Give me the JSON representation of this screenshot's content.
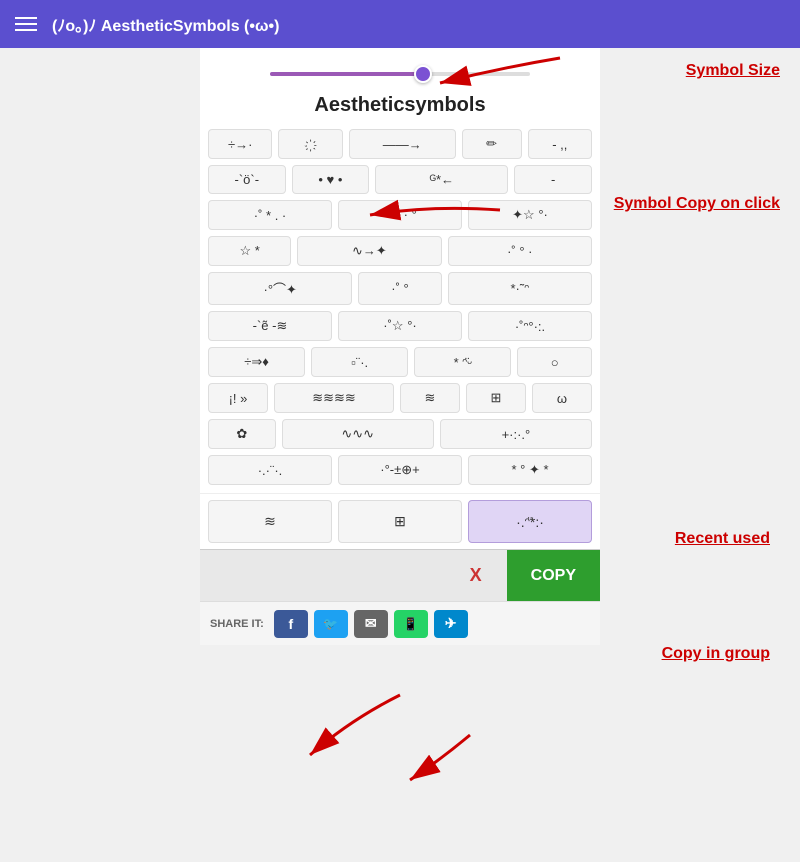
{
  "header": {
    "title": "(ﾉo。)ﾉ AestheticSymbols (•ω•)",
    "hamburger_label": "menu"
  },
  "slider": {
    "value": 60,
    "label": "Symbol Size"
  },
  "section": {
    "title": "Aestheticsymbols"
  },
  "symbols": {
    "rows": [
      [
        "÷→·",
        "҉",
        "——→",
        "✏",
        "- ,,"
      ],
      [
        "-`ö`-",
        "• ♥ •",
        "ᴳ*←",
        "-"
      ],
      [
        "·˚ * . ·",
        "°♡ · °",
        "✦☆ °·"
      ],
      [
        "☆ *",
        "∿→✦",
        "·˚ ° ·"
      ],
      [
        "·°⌒✦",
        "·˚ °",
        "*·˜ᵔ"
      ],
      [
        "-`ẽ -≋",
        "·˚☆ °·",
        "·˚ᵔ°·:."
      ],
      [
        "÷⇒♦",
        "▫¨·.",
        "* ᵔ̈ᵕ",
        "○"
      ],
      [
        "¡! »",
        "≋≋≋≋",
        "≋",
        "⊞",
        "ω"
      ],
      [
        "✿",
        "∿∿∿",
        "+·:·.°"
      ],
      [
        "·.·¨·.",
        "·°-±⊕+",
        "* ° ✦ *"
      ],
      [
        "≋",
        "⊞",
        "·.ᵔ̈*:·"
      ]
    ],
    "selected": [
      "≋",
      "⊞",
      "·.ᵔ̈*:·"
    ]
  },
  "copy_bar": {
    "clear_label": "X",
    "copy_label": "COPY"
  },
  "share_bar": {
    "label": "SHARE IT:",
    "buttons": [
      {
        "name": "facebook",
        "symbol": "f",
        "color": "#3b5998"
      },
      {
        "name": "twitter",
        "symbol": "t",
        "color": "#1da1f2"
      },
      {
        "name": "email",
        "symbol": "✉",
        "color": "#666666"
      },
      {
        "name": "whatsapp",
        "symbol": "w",
        "color": "#25d366"
      },
      {
        "name": "telegram",
        "symbol": "✈",
        "color": "#0088cc"
      }
    ]
  },
  "annotations": {
    "symbol_size": "Symbol Size",
    "symbol_copy": "Symbol Copy on click",
    "recent_used": "Recent used",
    "copy_in_group": "Copy in group"
  }
}
